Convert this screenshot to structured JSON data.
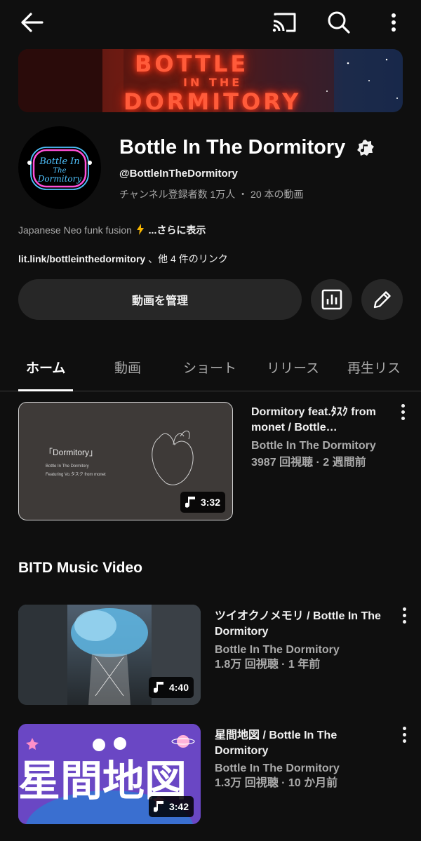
{
  "topbar": {
    "back_icon": "arrow-left-icon",
    "cast_icon": "cast-icon",
    "search_icon": "search-icon",
    "more_icon": "more-vert-icon"
  },
  "banner": {
    "line1": "BOTTLE",
    "line2": "IN THE",
    "line3": "DORMITORY"
  },
  "channel": {
    "avatar_line1": "Bottle In",
    "avatar_line2": "The",
    "avatar_line3": "Dormitory",
    "name": "Bottle In The Dormitory",
    "verified_icon": "music-note-badge-icon",
    "handle": "@BottleInTheDormitory",
    "stats": "チャンネル登録者数 1万人 ・ 20 本の動画",
    "description": "Japanese Neo funk fusion",
    "description_more": "...さらに表示",
    "link_main": "lit.link/bottleinthedormitory",
    "link_suffix": "、他 4 件のリンク"
  },
  "actions": {
    "manage_label": "動画を管理",
    "analytics_icon": "analytics-icon",
    "edit_icon": "pencil-icon"
  },
  "tabs": [
    {
      "label": "ホーム",
      "active": true
    },
    {
      "label": "動画",
      "active": false
    },
    {
      "label": "ショート",
      "active": false
    },
    {
      "label": "リリース",
      "active": false
    },
    {
      "label": "再生リス",
      "active": false
    }
  ],
  "featured": {
    "thumb_title": "「Dormitory」",
    "thumb_sub1": "Bottle In The Dormitory",
    "thumb_sub2": "Featuring Vo.タスク from monet",
    "duration": "3:32",
    "title": "Dormitory feat.ﾀｽｸ from monet / Bottle…",
    "channel": "Bottle In The Dormitory",
    "meta": "3987 回視聴 · 2 週間前"
  },
  "section": {
    "title": "BITD Music Video",
    "videos": [
      {
        "title": "ツイオクノメモリ / Bottle In The Dormitory",
        "channel": "Bottle In The Dormitory",
        "meta": "1.8万 回視聴 · 1 年前",
        "duration": "4:40"
      },
      {
        "title": "星間地図 / Bottle In The Dormitory",
        "channel": "Bottle In The Dormitory",
        "meta": "1.3万 回視聴 · 10 か月前",
        "duration": "3:42",
        "thumb_text": "星間地図"
      }
    ]
  },
  "colors": {
    "background": "#0f0f0f",
    "button": "#272727",
    "secondary_text": "#aaaaaa"
  }
}
